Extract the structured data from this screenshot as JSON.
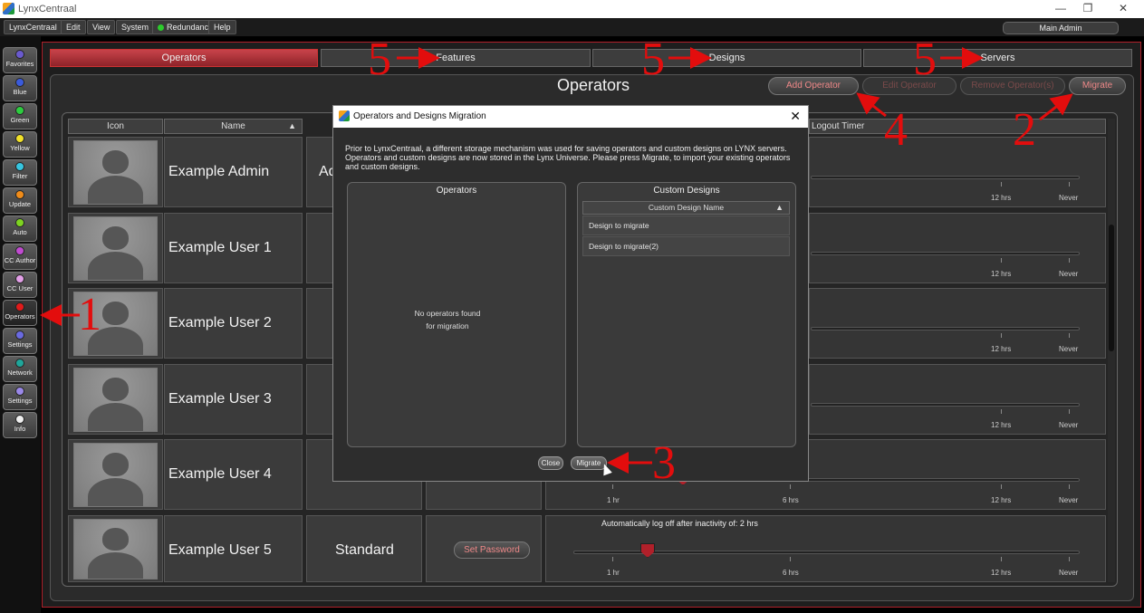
{
  "window": {
    "title": "LynxCentraal",
    "controls": [
      "—",
      "❐",
      "✕"
    ]
  },
  "menubar": {
    "items": [
      {
        "label": "LynxCentraal"
      },
      {
        "label": "Edit"
      },
      {
        "label": "View"
      },
      {
        "label": "System"
      },
      {
        "label": "Redundancy",
        "status_color": "#2ccb2c"
      },
      {
        "label": "Help"
      }
    ],
    "user": "Main Admin"
  },
  "leftnav": [
    {
      "label": "Favorites",
      "led": "#6a5acd"
    },
    {
      "label": "Blue",
      "led": "#3b5bdb"
    },
    {
      "label": "Green",
      "led": "#2ecc40"
    },
    {
      "label": "Yellow",
      "led": "#f1e12a"
    },
    {
      "label": "Filter",
      "led": "#37c5e0"
    },
    {
      "label": "Update",
      "led": "#f08c1a"
    },
    {
      "label": "Auto",
      "led": "#7ed321"
    },
    {
      "label": "CC Author",
      "led": "#c04bd0"
    },
    {
      "label": "CC User",
      "led": "#e3a0e8"
    },
    {
      "label": "Operators",
      "led": "#e01b1b",
      "active": true
    },
    {
      "label": "Settings",
      "led": "#6a6ae0"
    },
    {
      "label": "Network",
      "led": "#1fa59a"
    },
    {
      "label": "Settings",
      "led": "#9a88e8"
    },
    {
      "label": "Info",
      "led": "#f0f0f0"
    }
  ],
  "tabs": [
    "Operators",
    "Features",
    "Designs",
    "Servers"
  ],
  "panel": {
    "title": "Operators",
    "buttons": {
      "add": "Add Operator",
      "edit": "Edit Operator",
      "remove": "Remove Operator(s)",
      "migrate": "Migrate"
    }
  },
  "grid": {
    "columns": {
      "icon": "Icon",
      "name": "Name",
      "logout": "Logout Timer"
    },
    "rows": [
      {
        "name": "Example Admin",
        "role": "Ad"
      },
      {
        "name": "Example User 1"
      },
      {
        "name": "Example User 2"
      },
      {
        "name": "Example User 3"
      },
      {
        "name": "Example User 4"
      },
      {
        "name": "Example User 5",
        "role": "Standard",
        "password_button": "Set Password",
        "timer_text": "Automatically log off after inactivity of:  2 hrs"
      }
    ],
    "tick_labels": [
      "1 hr",
      "6 hrs",
      "12 hrs",
      "Never"
    ]
  },
  "dialog": {
    "title": "Operators and Designs Migration",
    "message": "Prior to LynxCentraal, a different storage mechanism was used for saving operators and custom designs on LYNX servers. Operators and custom designs are now stored in the Lynx Universe. Please press Migrate, to import your existing operators and custom designs.",
    "operators_title": "Operators",
    "operators_empty_1": "No operators found",
    "operators_empty_2": "for migration",
    "designs_title": "Custom Designs",
    "designs_column": "Custom Design Name",
    "designs": [
      "Design to migrate",
      "Design to migrate(2)"
    ],
    "close_label": "Close",
    "migrate_label": "Migrate"
  },
  "annotations": {
    "n1": "1",
    "n2": "2",
    "n3": "3",
    "n4": "4",
    "n5": "5"
  },
  "colors": {
    "accent_red": "#b0202a",
    "annotation_red": "#e30d0d"
  }
}
